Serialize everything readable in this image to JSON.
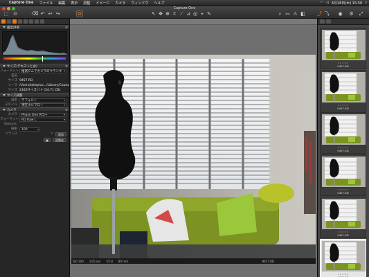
{
  "menubar": {
    "apple_glyph": "",
    "items": [
      "Capture One",
      "ファイル",
      "編集",
      "表示",
      "調整",
      "イメージ",
      "カメラ",
      "ウィンドウ",
      "ヘルプ"
    ],
    "clock": "4月18日(木) 15:50"
  },
  "window": {
    "title": "Capture One",
    "traffic_light_colors": [
      "#e0443e",
      "#dea123",
      "#4fb540"
    ]
  },
  "left_panel": {
    "sections": [
      {
        "title": "露出評価"
      },
      {
        "title": "サイズ"
      }
    ],
    "histogram_color": "#6a7d88",
    "metadata_section": "サイズ(テキストとお)",
    "meta": {
      "format_label": "フォーマット",
      "format_value": "推測タムでカメラのウランネ",
      "name_label": "名前",
      "name_value": "",
      "size_label": "サイズ",
      "size_value": "9457.RD",
      "folder_label": "ソース",
      "folder_value": "/Users/takeplus.../Library/Capture",
      "dims_label": "サイズ",
      "dims_value": "2160サイズバト (54.71 CB)"
    },
    "style_section": "サイズ調整",
    "style": {
      "profile_label": "設定",
      "profile_value": "デフォルト",
      "mode_label": "スタイル",
      "mode_value": "現在ホルマロー"
    },
    "lens_section": "カメラ",
    "lens": {
      "camera_label": "カメラ",
      "camera_value": "Phase One P25+",
      "format_label": "フォーマット",
      "format_value": "RD Raw L",
      "sensors_label": "Sensors",
      "iso_label": "倍率",
      "iso_value": "100",
      "balance_label": "バランス",
      "apply_button": "適用",
      "reset_button": "初期化"
    }
  },
  "viewer": {
    "info": [
      "ISO 100",
      "1/25 sec",
      "f/2.8",
      "80 mm"
    ],
    "filename": "9457.RD"
  },
  "browser": {
    "thumbnails": [
      {
        "caption": "9457.RD",
        "stars": "★★★★★"
      },
      {
        "caption": "9457.RD",
        "stars": "★★★★★"
      },
      {
        "caption": "9457.RD",
        "stars": "★★★★★"
      },
      {
        "caption": "9457.RD",
        "stars": "★★★★★"
      },
      {
        "caption": "9457.RD",
        "stars": "★★★★★"
      },
      {
        "caption": "9457.RD",
        "stars": "★★★★★"
      }
    ],
    "selected_index": 5
  },
  "colors": {
    "accent": "#e87a1d",
    "panel": "#262626",
    "viewer_bg": "#6f6f6f"
  }
}
